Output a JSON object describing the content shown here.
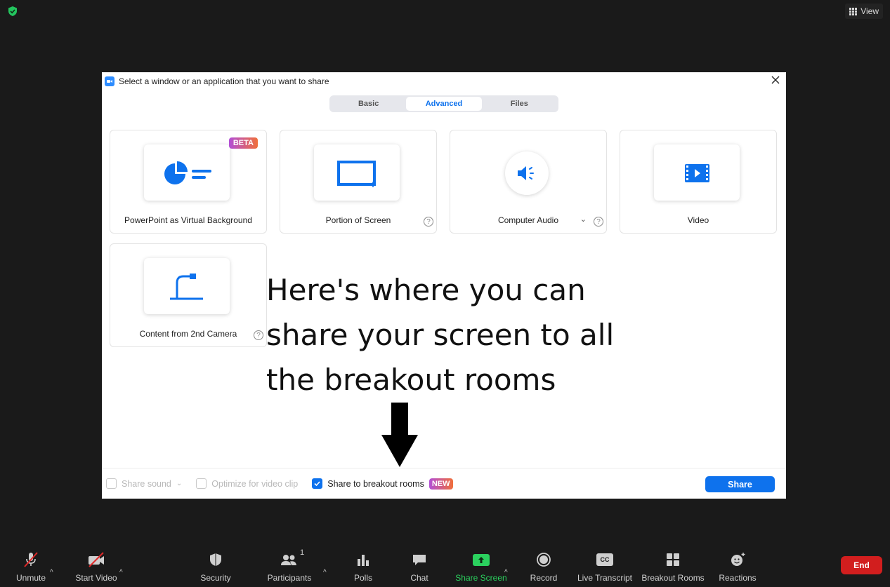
{
  "top": {
    "view_label": "View"
  },
  "dialog": {
    "title": "Select a window or an application that you want to share",
    "tabs": [
      {
        "label": "Basic",
        "active": false
      },
      {
        "label": "Advanced",
        "active": true
      },
      {
        "label": "Files",
        "active": false
      }
    ],
    "cards": [
      {
        "label": "PowerPoint as Virtual Background",
        "badge": "BETA",
        "icon": "powerpoint-icon"
      },
      {
        "label": "Portion of Screen",
        "help": "?",
        "icon": "portion-screen-icon"
      },
      {
        "label": "Computer Audio",
        "help": "?",
        "icon": "audio-icon"
      },
      {
        "label": "Video",
        "icon": "video-file-icon"
      },
      {
        "label": "Content from 2nd Camera",
        "help": "?",
        "icon": "camera-icon"
      }
    ],
    "annotation": [
      "Here's where you can",
      "share your screen to all",
      "the breakout rooms"
    ],
    "footer": {
      "share_sound": "Share sound",
      "optimize": "Optimize for video clip",
      "breakout": "Share to breakout rooms",
      "new_badge": "NEW",
      "share_button": "Share"
    }
  },
  "toolbar": {
    "unmute": "Unmute",
    "start_video": "Start Video",
    "security": "Security",
    "participants": "Participants",
    "participants_count": "1",
    "polls": "Polls",
    "chat": "Chat",
    "share_screen": "Share Screen",
    "record": "Record",
    "live_transcript": "Live Transcript",
    "cc_badge": "CC",
    "breakout_rooms": "Breakout Rooms",
    "reactions": "Reactions",
    "end": "End"
  },
  "colors": {
    "accent": "#0e72ed",
    "share_green": "#2bd15e",
    "end_red": "#d21e1e",
    "bg": "#1a1a1a"
  }
}
